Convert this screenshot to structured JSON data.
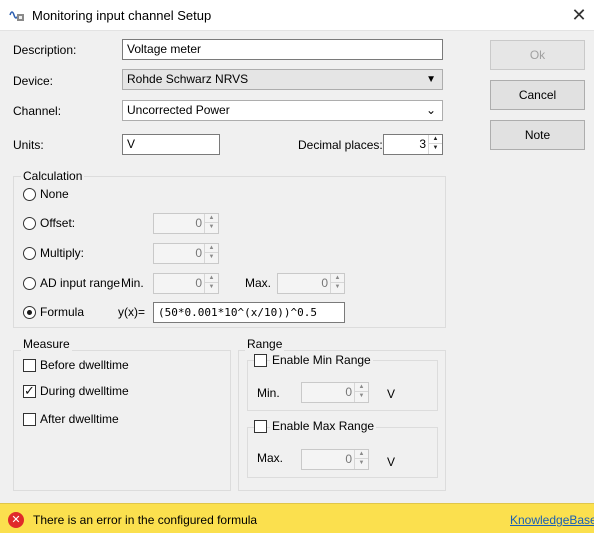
{
  "window": {
    "title": "Monitoring input channel Setup",
    "icon": "sine-wave-settings-icon",
    "close_glyph": "✕"
  },
  "form": {
    "description_label": "Description:",
    "description_value": "Voltage meter",
    "device_label": "Device:",
    "device_value": "Rohde  Schwarz NRVS",
    "channel_label": "Channel:",
    "channel_value": "Uncorrected Power",
    "units_label": "Units:",
    "units_value": "V",
    "decimal_label": "Decimal places:",
    "decimal_value": "3"
  },
  "buttons": {
    "ok": "Ok",
    "cancel": "Cancel",
    "note": "Note"
  },
  "calculation": {
    "title": "Calculation",
    "none_label": "None",
    "offset_label": "Offset:",
    "offset_value": "0",
    "multiply_label": "Multiply:",
    "multiply_value": "0",
    "ad_label": "AD input range",
    "min_label": "Min.",
    "min_value": "0",
    "max_label": "Max.",
    "max_value": "0",
    "formula_label": "Formula",
    "formula_prefix": "y(x)=",
    "formula_value": "(50*0.001*10^(x/10))^0.5",
    "selected": "formula"
  },
  "measure": {
    "title": "Measure",
    "before": "Before dwelltime",
    "during": "During dwelltime",
    "after": "After dwelltime",
    "checked": "during"
  },
  "range": {
    "title": "Range",
    "enable_min": "Enable Min Range",
    "min_label": "Min.",
    "min_value": "0",
    "min_unit": "V",
    "enable_max": "Enable Max Range",
    "max_label": "Max.",
    "max_value": "0",
    "max_unit": "V"
  },
  "status": {
    "message": "There is an error in the configured formula",
    "link": "KnowledgeBase",
    "icon": "error-icon",
    "color": "#fbe04e"
  }
}
